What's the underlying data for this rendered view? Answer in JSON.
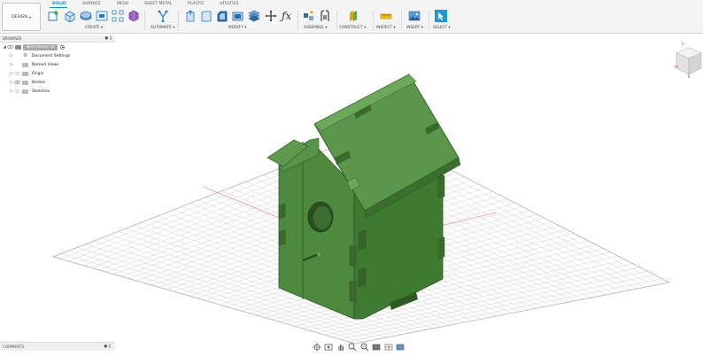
{
  "toolbar": {
    "design_label": "DESIGN",
    "tabs": [
      {
        "label": "SOLID",
        "active": true
      },
      {
        "label": "SURFACE"
      },
      {
        "label": "MESH"
      },
      {
        "label": "SHEET METAL"
      },
      {
        "label": "PLASTIC"
      },
      {
        "label": "UTILITIES"
      }
    ],
    "groups": {
      "create": "CREATE ▾",
      "automate": "AUTOMATE ▾",
      "modify": "MODIFY ▾",
      "assemble": "ASSEMBLE ▾",
      "construct": "CONSTRUCT ▾",
      "inspect": "INSPECT ▾",
      "insert": "INSERT ▾",
      "select": "SELECT ▾"
    },
    "icons": {
      "sketch": "create-sketch-icon",
      "extrude": "extrude-icon",
      "revolve": "revolve-icon",
      "form": "create-form-icon",
      "automate": "automate-icon",
      "press_pull": "press-pull-icon",
      "fillet": "fillet-icon",
      "fx": "ƒx"
    },
    "accent_color": "#0696d7"
  },
  "browser": {
    "title": "BROWSER",
    "root_label": "Bird House v4",
    "items": [
      {
        "label": "Document Settings",
        "icon": "gear-icon"
      },
      {
        "label": "Named Views",
        "icon": "folder-icon"
      },
      {
        "label": "Origin",
        "icon": "folder-icon"
      },
      {
        "label": "Bodies",
        "icon": "folder-icon"
      },
      {
        "label": "Sketches",
        "icon": "folder-icon"
      }
    ]
  },
  "comments": {
    "title": "COMMENTS"
  },
  "model": {
    "body_color": "#4a7f3a",
    "name": "bird house"
  }
}
